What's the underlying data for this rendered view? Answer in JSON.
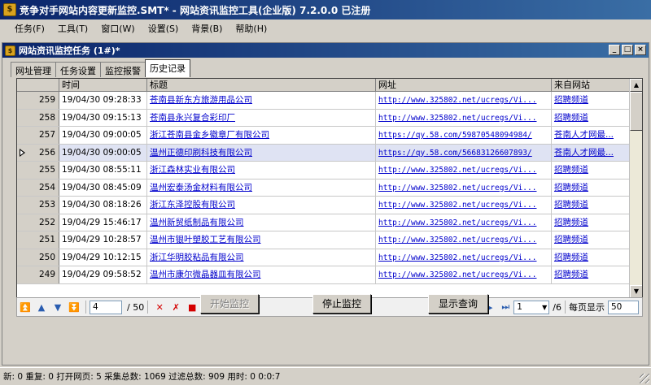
{
  "app": {
    "icon_glyph": "$",
    "title": "竞争对手网站内容更新监控.SMT* - 网站资讯监控工具(企业版) 7.2.0.0  已注册"
  },
  "menu": [
    "任务(F)",
    "工具(T)",
    "窗口(W)",
    "设置(S)",
    "背景(B)",
    "帮助(H)"
  ],
  "child_window": {
    "title": "网站资讯监控任务  (1#)*",
    "buttons": [
      "_",
      "□",
      "×"
    ]
  },
  "tabs": [
    "网址管理",
    "任务设置",
    "监控报警",
    "历史记录"
  ],
  "active_tab": 3,
  "grid": {
    "columns": [
      "",
      "时间",
      "标题",
      "网址",
      "来自网站"
    ],
    "rows": [
      {
        "no": "259",
        "time": "19/04/30 09:28:33",
        "title": "苍南县新东方旅游用品公司",
        "url": "http://www.325802.net/ucregs/Vi...",
        "site": "招聘频道"
      },
      {
        "no": "258",
        "time": "19/04/30 09:15:13",
        "title": "苍南县永兴复合彩印厂",
        "url": "http://www.325802.net/ucregs/Vi...",
        "site": "招聘频道"
      },
      {
        "no": "257",
        "time": "19/04/30 09:00:05",
        "title": "浙江苍南县金乡徽章厂有限公司",
        "url": "https://qy.58.com/59870548094984/",
        "site": "苍南人才网最..."
      },
      {
        "no": "256",
        "time": "19/04/30 09:00:05",
        "title": "温州正德印刷科技有限公司",
        "url": "https://qy.58.com/56683126607893/",
        "site": "苍南人才网最..."
      },
      {
        "no": "255",
        "time": "19/04/30 08:55:11",
        "title": "浙江森林实业有限公司",
        "url": "http://www.325802.net/ucregs/Vi...",
        "site": "招聘频道"
      },
      {
        "no": "254",
        "time": "19/04/30 08:45:09",
        "title": "温州宏泰汤金材料有限公司",
        "url": "http://www.325802.net/ucregs/Vi...",
        "site": "招聘频道"
      },
      {
        "no": "253",
        "time": "19/04/30 08:18:26",
        "title": "浙江东泽控股有限公司",
        "url": "http://www.325802.net/ucregs/Vi...",
        "site": "招聘频道"
      },
      {
        "no": "252",
        "time": "19/04/29 15:46:17",
        "title": "温州新贸纸制品有限公司",
        "url": "http://www.325802.net/ucregs/Vi...",
        "site": "招聘频道"
      },
      {
        "no": "251",
        "time": "19/04/29 10:28:57",
        "title": "温州市银叶塑胶工艺有限公司",
        "url": "http://www.325802.net/ucregs/Vi...",
        "site": "招聘频道"
      },
      {
        "no": "250",
        "time": "19/04/29 10:12:15",
        "title": "浙江华明胶粘品有限公司",
        "url": "http://www.325802.net/ucregs/Vi...",
        "site": "招聘频道"
      },
      {
        "no": "249",
        "time": "19/04/29 09:58:52",
        "title": "温州市康尔微晶器皿有限公司",
        "url": "http://www.325802.net/ucregs/Vi...",
        "site": "招聘频道"
      }
    ],
    "selected_row": 3
  },
  "nav": {
    "current": "4",
    "total": "/ 50",
    "page": "1",
    "pages": "/6",
    "per_page_label": "每页显示",
    "per_page": "50"
  },
  "buttons": {
    "start": "开始监控",
    "stop": "停止监控",
    "query": "显示查询"
  },
  "status": "新: 0 重复: 0 打开网页: 5 采集总数: 1069 过滤总数: 909 用时: 0 0:0:7"
}
